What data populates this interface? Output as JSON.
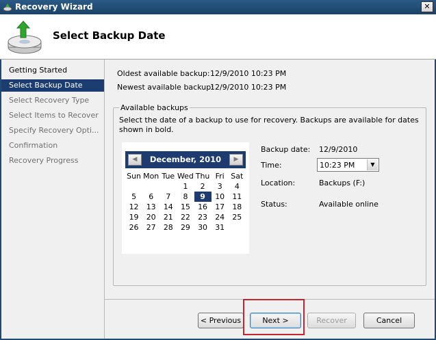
{
  "window": {
    "title": "Recovery Wizard",
    "close_glyph": "✕"
  },
  "header": {
    "title": "Select Backup Date",
    "icon": "backup-drive-icon"
  },
  "nav": {
    "items": [
      {
        "label": "Getting Started",
        "state": "done"
      },
      {
        "label": "Select Backup Date",
        "state": "active"
      },
      {
        "label": "Select Recovery Type",
        "state": "pending"
      },
      {
        "label": "Select Items to Recover",
        "state": "pending"
      },
      {
        "label": "Specify Recovery Opti...",
        "state": "pending"
      },
      {
        "label": "Confirmation",
        "state": "pending"
      },
      {
        "label": "Recovery Progress",
        "state": "pending"
      }
    ]
  },
  "info": {
    "oldest_label": "Oldest available backup:",
    "oldest_value": "12/9/2010 10:23 PM",
    "newest_label": "Newest available backup:",
    "newest_value": "12/9/2010 10:23 PM"
  },
  "available": {
    "title": "Available backups",
    "description": "Select the date of a backup to use for recovery. Backups are available for dates shown in bold."
  },
  "calendar": {
    "month": "December, 2010",
    "prev_glyph": "◀",
    "next_glyph": "▶",
    "days_of_week": [
      "Sun",
      "Mon",
      "Tue",
      "Wed",
      "Thu",
      "Fri",
      "Sat"
    ],
    "weeks": [
      [
        "",
        "",
        "",
        "1",
        "2",
        "3",
        "4"
      ],
      [
        "5",
        "6",
        "7",
        "8",
        "9",
        "10",
        "11"
      ],
      [
        "12",
        "13",
        "14",
        "15",
        "16",
        "17",
        "18"
      ],
      [
        "19",
        "20",
        "21",
        "22",
        "23",
        "24",
        "25"
      ],
      [
        "26",
        "27",
        "28",
        "29",
        "30",
        "31",
        ""
      ]
    ],
    "selected": "9"
  },
  "details": {
    "backup_date_label": "Backup date:",
    "backup_date_value": "12/9/2010",
    "time_label": "Time:",
    "time_value": "10:23 PM",
    "location_label": "Location:",
    "location_value": "Backups (F:)",
    "status_label": "Status:",
    "status_value": "Available online"
  },
  "buttons": {
    "previous": "< Previous",
    "next": "Next >",
    "recover": "Recover",
    "cancel": "Cancel"
  },
  "colors": {
    "accent": "#1c3d70",
    "title_bar": "#1c4266",
    "highlight": "#c0262c"
  }
}
